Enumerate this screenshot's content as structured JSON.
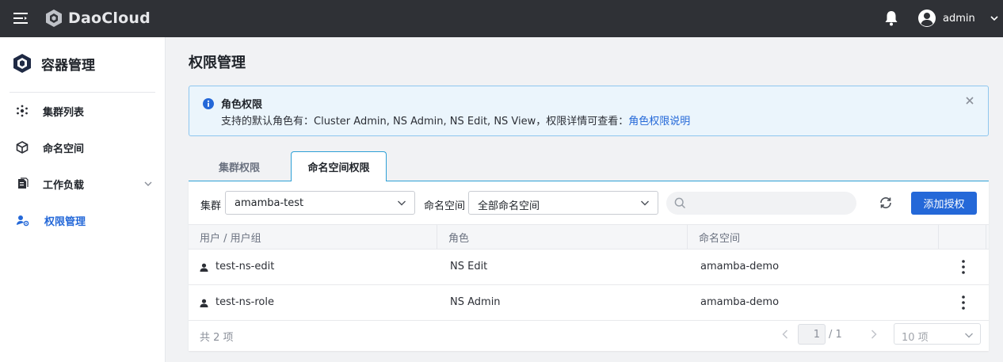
{
  "topbar": {
    "brand": "DaoCloud",
    "username": "admin"
  },
  "sidebar": {
    "title": "容器管理",
    "items": [
      {
        "label": "集群列表",
        "icon": "cluster-icon"
      },
      {
        "label": "命名空间",
        "icon": "cube-icon"
      },
      {
        "label": "工作负载",
        "icon": "workload-icon",
        "expandable": true
      },
      {
        "label": "权限管理",
        "icon": "user-permission-icon",
        "active": true
      }
    ]
  },
  "main": {
    "title": "权限管理",
    "alert": {
      "title": "角色权限",
      "body": "支持的默认角色有：Cluster Admin, NS Admin, NS Edit, NS View，权限详情可查看：",
      "link": "角色权限说明"
    },
    "tabs": [
      {
        "label": "集群权限"
      },
      {
        "label": "命名空间权限",
        "active": true
      }
    ],
    "filters": {
      "cluster_label": "集群",
      "cluster_value": "amamba-test",
      "namespace_label": "命名空间",
      "namespace_value": "全部命名空间",
      "search_placeholder": ""
    },
    "add_button": "添加授权",
    "table": {
      "columns": [
        "用户 / 用户组",
        "角色",
        "命名空间"
      ],
      "rows": [
        {
          "user": "test-ns-edit",
          "role": "NS Edit",
          "namespace": "amamba-demo"
        },
        {
          "user": "test-ns-role",
          "role": "NS Admin",
          "namespace": "amamba-demo"
        }
      ]
    },
    "pagination": {
      "total_text": "共 2 项",
      "current_page": "1",
      "total_pages": "/ 1",
      "page_size": "10 项"
    }
  },
  "colors": {
    "accent": "#2468d8",
    "topbar": "#2f3136",
    "alert_bg": "#ebf5fc",
    "alert_border": "#8ec6ee"
  }
}
